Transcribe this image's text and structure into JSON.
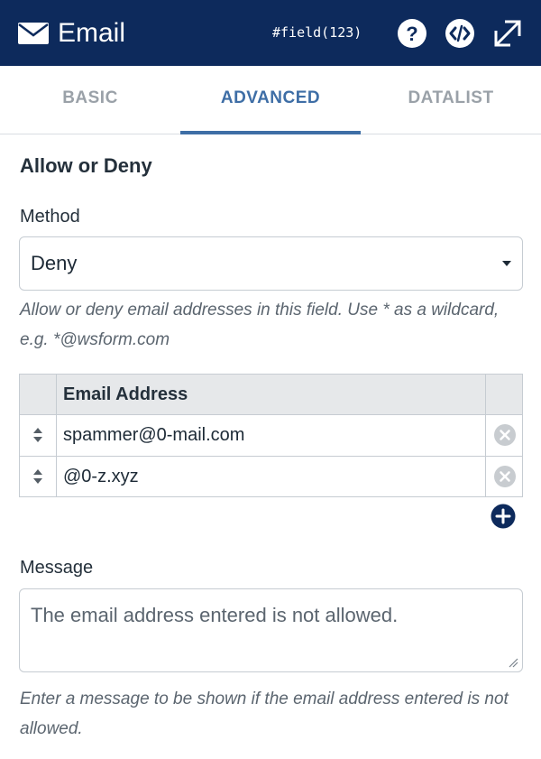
{
  "header": {
    "title": "Email",
    "shortcode": "#field(123)",
    "icons": {
      "logo": "envelope-icon",
      "help": "question-circle-icon",
      "code": "code-circle-icon",
      "expand": "expand-arrows-icon"
    }
  },
  "tabs": [
    {
      "label": "BASIC",
      "active": false
    },
    {
      "label": "ADVANCED",
      "active": true
    },
    {
      "label": "DATALIST",
      "active": false
    }
  ],
  "section": {
    "title": "Allow or Deny",
    "method": {
      "label": "Method",
      "value": "Deny",
      "help": "Allow or deny email addresses in this field. Use * as a wildcard, e.g. *@wsform.com"
    },
    "table": {
      "header": "Email Address",
      "rows": [
        {
          "email": "spammer@0-mail.com"
        },
        {
          "email": "@0-z.xyz"
        }
      ]
    },
    "message": {
      "label": "Message",
      "value": "The email address entered is not allowed.",
      "help": "Enter a message to be shown if the email address entered is not allowed."
    }
  },
  "colors": {
    "header_bg": "#0d2a5c",
    "accent": "#3e6ea6",
    "add_button": "#0d2a5c",
    "delete_icon": "#c8ccd0"
  }
}
